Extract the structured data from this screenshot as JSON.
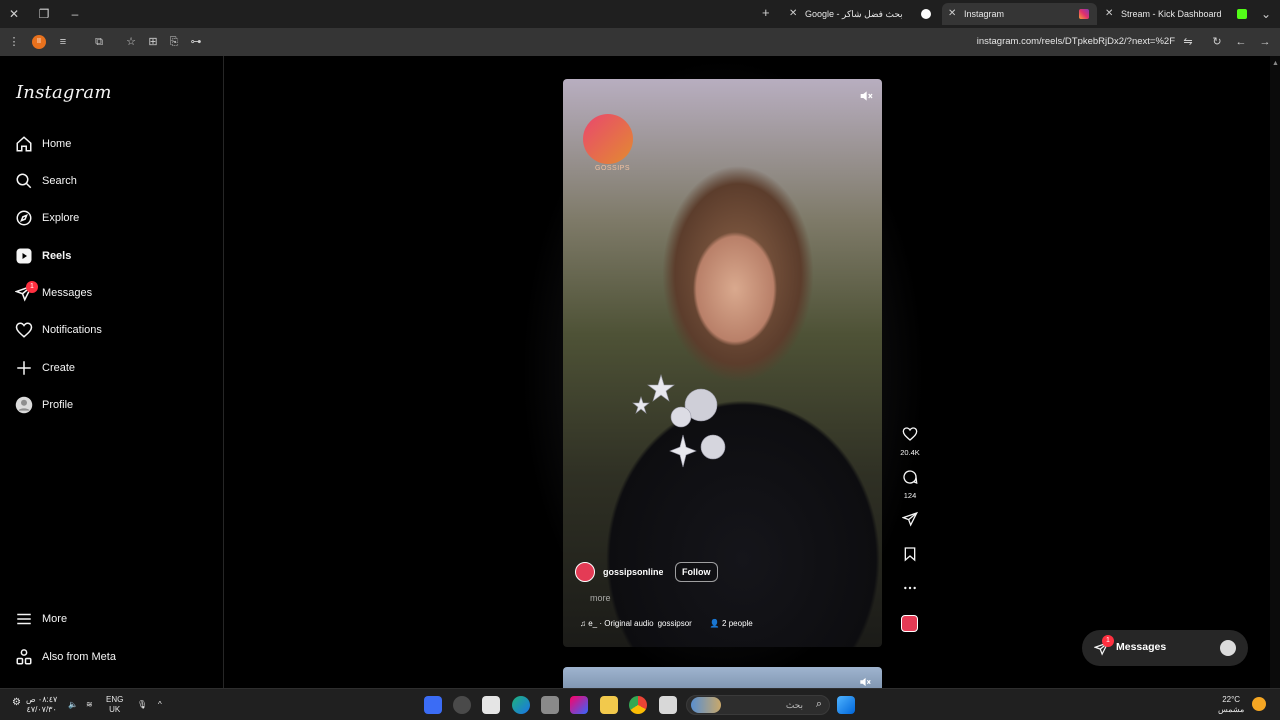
{
  "browser": {
    "tabs": [
      {
        "label": "Google - بحث فضل شاكر",
        "active": false
      },
      {
        "label": "Instagram",
        "active": true
      },
      {
        "label": "Stream - Kick Dashboard",
        "active": false
      }
    ],
    "new_tab": "+",
    "url": "instagram.com/reels/DTpkebRjDx2/?next=%2F",
    "extension_badge": "II"
  },
  "instagram": {
    "logo": "Instagram",
    "nav": [
      {
        "label": "Home",
        "icon": "home-icon"
      },
      {
        "label": "Search",
        "icon": "search-icon"
      },
      {
        "label": "Explore",
        "icon": "compass-icon"
      },
      {
        "label": "Reels",
        "icon": "reels-icon"
      },
      {
        "label": "Messages",
        "icon": "messenger-icon",
        "badge": "1"
      },
      {
        "label": "Notifications",
        "icon": "heart-icon"
      },
      {
        "label": "Create",
        "icon": "plus-icon"
      },
      {
        "label": "Profile",
        "icon": "avatar"
      }
    ],
    "bottom_nav": [
      {
        "label": "More",
        "icon": "menu-icon"
      },
      {
        "label": "Also from Meta",
        "icon": "meta-icon"
      }
    ],
    "reel": {
      "logo_text": "GOSSIPS",
      "username": "gossipsonline",
      "follow_label": "Follow",
      "more_label": "more",
      "audio_label": "e_ · Original audio",
      "audio_user": "gossipsor",
      "people_label": "2 people"
    },
    "actions": {
      "likes": "20.4K",
      "comments": "124"
    },
    "messages_pill": {
      "label": "Messages",
      "badge": "1"
    }
  },
  "taskbar": {
    "time": "٠٨:٤٧ ص",
    "date": "٤٧/٠٧/٣٠",
    "lang": "ENG",
    "lang2": "UK",
    "search_placeholder": "بحث",
    "weather_temp": "22°C",
    "weather_desc": "مشمس"
  }
}
